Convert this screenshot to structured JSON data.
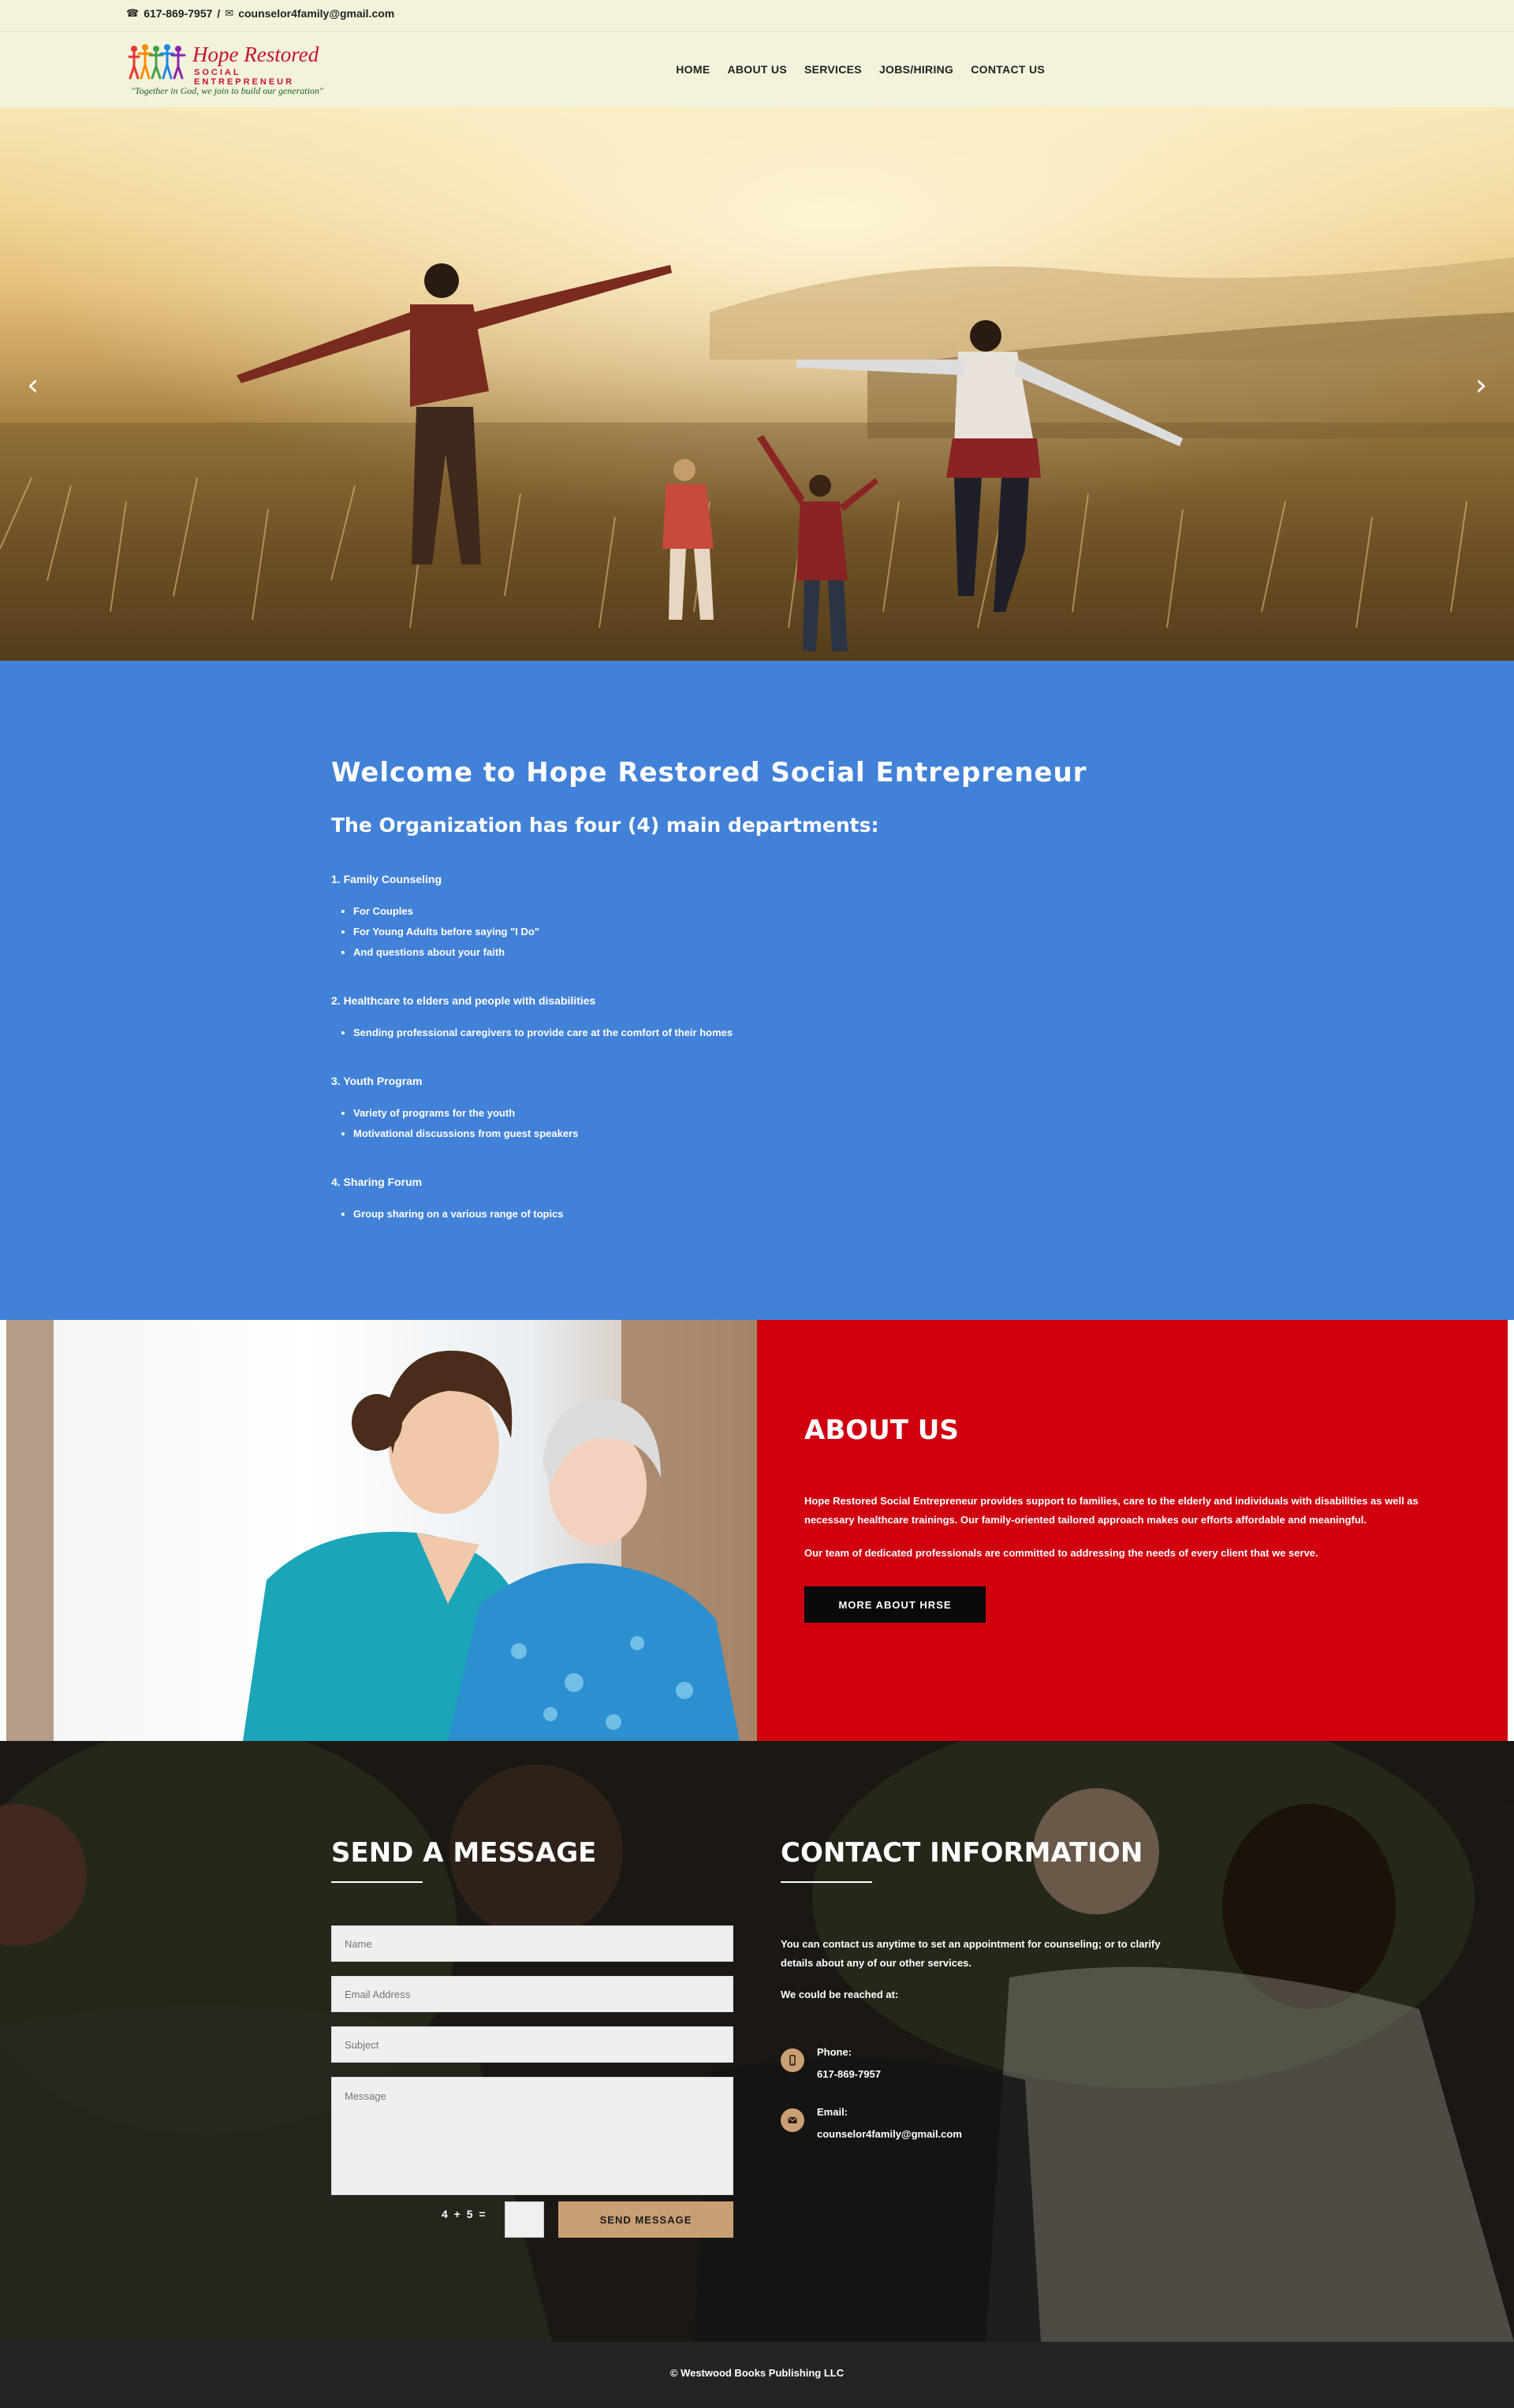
{
  "topbar": {
    "phone_icon": "phone-icon",
    "phone": "617-869-7957",
    "separator": "/",
    "email_icon": "envelope-icon",
    "email": "counselor4family@gmail.com"
  },
  "header": {
    "logo": {
      "brand_line1": "Hope Restored",
      "brand_line2": "SOCIAL ENTREPRENEUR",
      "tagline": "\"Together in God, we join to build our generation\""
    },
    "nav": [
      {
        "label": "HOME"
      },
      {
        "label": "ABOUT US"
      },
      {
        "label": "SERVICES"
      },
      {
        "label": "JOBS/HIRING"
      },
      {
        "label": "CONTACT US"
      }
    ]
  },
  "hero": {
    "prev_icon": "chevron-left-icon",
    "next_icon": "chevron-right-icon",
    "prev_glyph": "‹",
    "next_glyph": "›"
  },
  "welcome": {
    "title": "Welcome to Hope Restored Social Entrepreneur",
    "subtitle": "The Organization has four (4) main departments:",
    "departments": [
      {
        "heading": "1. Family Counseling",
        "items": [
          "For Couples",
          "For Young Adults before saying \"I Do\"",
          "And questions about your faith"
        ]
      },
      {
        "heading": "2. Healthcare to elders and people with disabilities",
        "items": [
          "Sending professional caregivers to provide care at the comfort of their homes"
        ]
      },
      {
        "heading": "3. Youth Program",
        "items": [
          "Variety of programs for the youth",
          "Motivational discussions from guest speakers"
        ]
      },
      {
        "heading": "4. Sharing Forum",
        "items": [
          "Group sharing on a various range of topics"
        ]
      }
    ]
  },
  "about": {
    "title": "ABOUT US",
    "paragraph1": "Hope Restored Social Entrepreneur provides support to families, care to the elderly and individuals with disabilities as well as necessary healthcare trainings. Our family-oriented tailored approach makes our efforts affordable and meaningful.",
    "paragraph2": "Our team of dedicated professionals are committed to addressing the needs of every client that we serve.",
    "button": "MORE ABOUT HRSE"
  },
  "contact": {
    "form_title": "SEND A MESSAGE",
    "name_placeholder": "Name",
    "email_placeholder": "Email Address",
    "subject_placeholder": "Subject",
    "message_placeholder": "Message",
    "captcha": "4 + 5 =",
    "send_button": "SEND MESSAGE",
    "info_title": "CONTACT INFORMATION",
    "info_text": "You can contact us anytime to set an appointment for counseling; or to clarify details about any of our other services.",
    "reach_text": "We could be reached at:",
    "phone_label": "Phone:",
    "phone_value": "617-869-7957",
    "phone_icon": "mobile-phone-icon",
    "email_label": "Email:",
    "email_value": "counselor4family@gmail.com",
    "email_icon": "envelope-icon"
  },
  "footer": {
    "copyright": "© Westwood Books Publishing LLC"
  },
  "colors": {
    "topbar_bg": "#f3f3dc",
    "welcome_bg": "#4281d8",
    "about_bg": "#d0000f",
    "accent_gold": "#c9a073",
    "footer_bg": "#242424"
  }
}
